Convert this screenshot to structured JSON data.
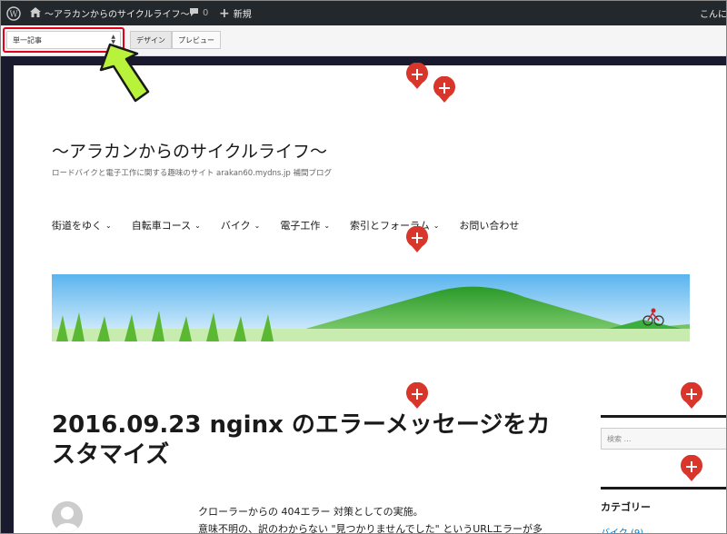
{
  "admin_bar": {
    "site_name": "〜アラカンからのサイクルライフ〜",
    "comments_count": "0",
    "new_label": "新規",
    "greeting": "こんに"
  },
  "toolbar": {
    "template_select_value": "単一記事",
    "design_label": "デザイン",
    "preview_label": "プレビュー"
  },
  "site": {
    "title": "〜アラカンからのサイクルライフ〜",
    "description": "ロードバイクと電子工作に関する趣味のサイト arakan60.mydns.jp 補間ブログ"
  },
  "nav": {
    "items": [
      {
        "label": "街道をゆく",
        "has_submenu": true
      },
      {
        "label": "自転車コース",
        "has_submenu": true
      },
      {
        "label": "バイク",
        "has_submenu": true
      },
      {
        "label": "電子工作",
        "has_submenu": true
      },
      {
        "label": "索引とフォーラム",
        "has_submenu": true
      },
      {
        "label": "お問い合わせ",
        "has_submenu": false
      }
    ]
  },
  "post": {
    "title": "2016.09.23 nginx のエラーメッセージをカスタマイズ",
    "lines": [
      "クローラーからの 404エラー 対策としての実施。",
      "意味不明の、訳のわからない \"見つかりませんでした\" というURLエラーが多"
    ]
  },
  "sidebar": {
    "search_placeholder": "検索 …",
    "category_heading": "カテゴリー",
    "category_item": "バイク (9)"
  },
  "colors": {
    "admin_bar": "#23282d",
    "highlight_border": "#e3001b",
    "plus_marker": "#d9362b",
    "arrow_fill": "#b8f23a"
  }
}
